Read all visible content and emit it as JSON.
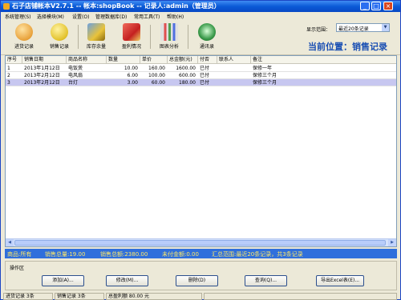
{
  "titlebar": {
    "title": "石子店铺帐本V2.7.1 -- 帐本:shopBook -- 记录人:admin（管理员）",
    "minimize": "_",
    "maximize": "□",
    "close": "×"
  },
  "menu": [
    "系统管理(S)",
    "选择模块(M)",
    "设置(O)",
    "管理数据库(D)",
    "常用工具(T)",
    "帮助(H)"
  ],
  "toolbar": {
    "buttons": [
      {
        "label": "进货记录",
        "icon": "purchase-icon"
      },
      {
        "label": "销售记录",
        "icon": "sales-icon"
      },
      {
        "label": "库存余量",
        "icon": "inventory-icon"
      },
      {
        "label": "盈利情况",
        "icon": "profit-icon"
      },
      {
        "label": "图表分析",
        "icon": "chart-icon"
      },
      {
        "label": "通讯录",
        "icon": "phone-icon"
      }
    ],
    "range_label": "显示范围：",
    "range_value": "最近20条记录",
    "position_title": "当前位置：销售记录"
  },
  "table": {
    "columns": [
      "序号",
      "销售日期",
      "商品名称",
      "数量",
      "单价",
      "总金额(元)",
      "付否",
      "联系人",
      "备注"
    ],
    "rows": [
      [
        "1",
        "2013年1月12日",
        "电饭煲",
        "10.00",
        "160.00",
        "1600.00",
        "已付",
        "",
        "保修一年"
      ],
      [
        "2",
        "2013年2月12日",
        "电风扇",
        "6.00",
        "100.00",
        "600.00",
        "已付",
        "",
        "保修三个月"
      ],
      [
        "3",
        "2013年2月12日",
        "台灯",
        "3.00",
        "60.00",
        "180.00",
        "已付",
        "",
        "保修三个月"
      ]
    ]
  },
  "summary": {
    "product": "商品:所有",
    "total_qty": "销售总量:19.00",
    "total_amount": "销售总额:2380.00",
    "unpaid": "未付金额:0.00",
    "range": "汇总范围:最近20条记录，共3条记录"
  },
  "ops": {
    "label": "操作区",
    "add": "添加(A)...",
    "edit": "修改(M)...",
    "delete": "删除(D)",
    "query": "查询(Q)...",
    "export": "导出Excel表(E)..."
  },
  "status": {
    "purchase_count": "进货记录 3条",
    "sales_count": "销售记录 3条",
    "profit": "总盈利额 80.00 元"
  },
  "colors": {
    "titlebar": "#0a5ad7",
    "summary_bg": "#2f6fdc",
    "summary_text": "#ffe866",
    "position_title": "#1a4fb3",
    "selected_row": "#c7c7f0"
  }
}
